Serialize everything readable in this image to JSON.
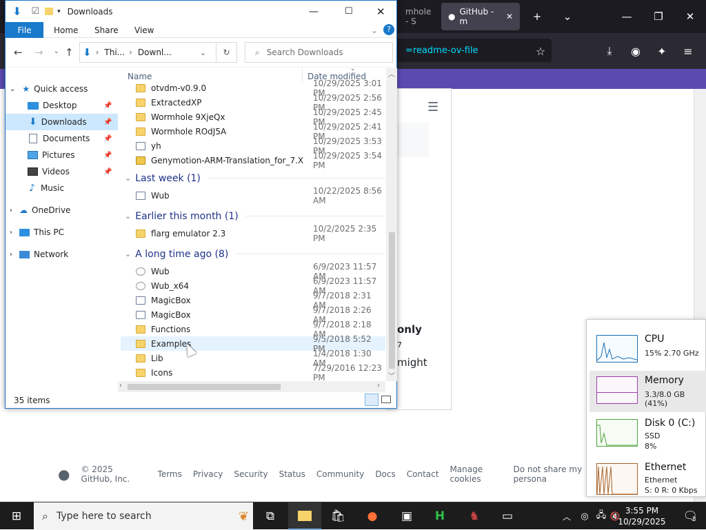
{
  "browser": {
    "tab_inactive": "mhole - S",
    "tab_active": "GitHub - m",
    "url_fragment": "=readme-ov-file",
    "page_text": {
      "only": "only",
      "seven": "7",
      "might": "might"
    },
    "footer": [
      "© 2025 GitHub, Inc.",
      "Terms",
      "Privacy",
      "Security",
      "Status",
      "Community",
      "Docs",
      "Contact",
      "Manage cookies",
      "Do not share my persona"
    ]
  },
  "explorer": {
    "title": "Downloads",
    "ribbon_tabs": [
      "File",
      "Home",
      "Share",
      "View"
    ],
    "address": {
      "segment1": "Thi...",
      "segment2": "Downl..."
    },
    "search_placeholder": "Search Downloads",
    "columns": {
      "name": "Name",
      "date": "Date modified"
    },
    "nav": [
      {
        "label": "Quick access",
        "pinned": false
      },
      {
        "label": "Desktop",
        "pinned": true
      },
      {
        "label": "Downloads",
        "pinned": true
      },
      {
        "label": "Documents",
        "pinned": true
      },
      {
        "label": "Pictures",
        "pinned": true
      },
      {
        "label": "Videos",
        "pinned": true
      },
      {
        "label": "Music",
        "pinned": false
      },
      {
        "label": "OneDrive",
        "pinned": false
      },
      {
        "label": "This PC",
        "pinned": false
      },
      {
        "label": "Network",
        "pinned": false
      }
    ],
    "items_top": [
      {
        "name": "otvdm-v0.9.0",
        "date": "10/29/2025 3:01 PM",
        "icon": "folder"
      },
      {
        "name": "ExtractedXP",
        "date": "10/29/2025 2:56 PM",
        "icon": "folder"
      },
      {
        "name": "Wormhole 9XjeQx",
        "date": "10/29/2025 2:45 PM",
        "icon": "folder"
      },
      {
        "name": "Wormhole ROdJ5A",
        "date": "10/29/2025 2:41 PM",
        "icon": "folder"
      },
      {
        "name": "yh",
        "date": "10/29/2025 3:53 PM",
        "icon": "doc"
      },
      {
        "name": "Genymotion-ARM-Translation_for_7.X",
        "date": "10/29/2025 3:54 PM",
        "icon": "zip"
      }
    ],
    "group_lastweek": "Last week (1)",
    "items_lastweek": [
      {
        "name": "Wub",
        "date": "10/22/2025 8:56 AM",
        "icon": "doc"
      }
    ],
    "group_earlier": "Earlier this month (1)",
    "items_earlier": [
      {
        "name": "flarg emulator 2.3",
        "date": "10/2/2025 2:35 PM",
        "icon": "folder"
      }
    ],
    "group_longago": "A long time ago (8)",
    "items_longago": [
      {
        "name": "Wub",
        "date": "6/9/2023 11:57 AM",
        "icon": "exe"
      },
      {
        "name": "Wub_x64",
        "date": "6/9/2023 11:57 AM",
        "icon": "exe"
      },
      {
        "name": "MagicBox",
        "date": "9/7/2018 2:31 AM",
        "icon": "doc"
      },
      {
        "name": "MagicBox",
        "date": "9/7/2018 2:26 AM",
        "icon": "doc"
      },
      {
        "name": "Functions",
        "date": "9/7/2018 2:18 AM",
        "icon": "folder"
      },
      {
        "name": "Examples",
        "date": "9/5/2018 5:52 PM",
        "icon": "folder"
      },
      {
        "name": "Lib",
        "date": "1/4/2018 1:30 AM",
        "icon": "folder"
      },
      {
        "name": "Icons",
        "date": "7/29/2016 12:23 PM",
        "icon": "folder"
      }
    ],
    "status": "35 items"
  },
  "perf": {
    "cpu": {
      "label": "CPU",
      "detail": "15%  2.70 GHz"
    },
    "memory": {
      "label": "Memory",
      "detail": "3.3/8.0 GB (41%)"
    },
    "disk": {
      "label": "Disk 0 (C:)",
      "detail1": "SSD",
      "detail2": "8%"
    },
    "ethernet": {
      "label": "Ethernet",
      "detail1": "Ethernet",
      "detail2": "S: 0  R: 0 Kbps"
    }
  },
  "taskbar": {
    "search_placeholder": "Type here to search",
    "time": "3:55 PM",
    "date": "10/29/2025",
    "notifications": "3"
  }
}
